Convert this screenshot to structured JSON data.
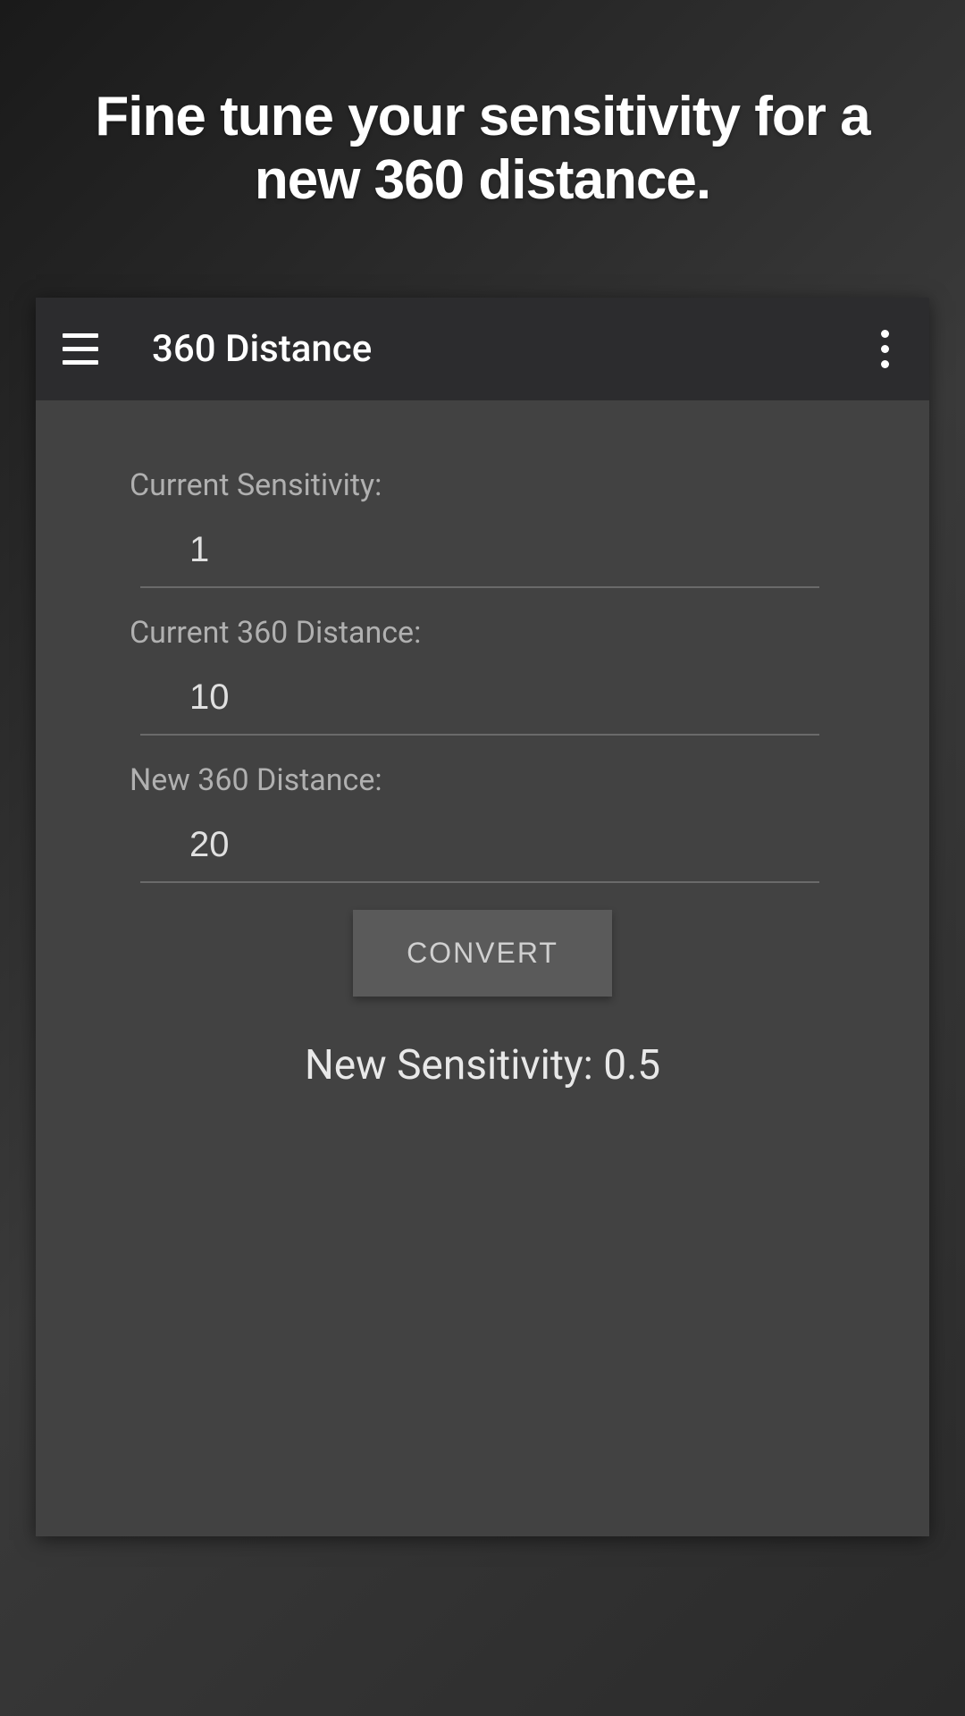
{
  "header": {
    "tagline": "Fine tune your sensitivity for a new 360 distance."
  },
  "appBar": {
    "title": "360 Distance"
  },
  "form": {
    "currentSensitivity": {
      "label": "Current Sensitivity:",
      "value": "1"
    },
    "currentDistance": {
      "label": "Current 360 Distance:",
      "value": "10"
    },
    "newDistance": {
      "label": "New 360 Distance:",
      "value": "20"
    },
    "convertButton": "CONVERT"
  },
  "result": {
    "text": "New Sensitivity: 0.5"
  }
}
